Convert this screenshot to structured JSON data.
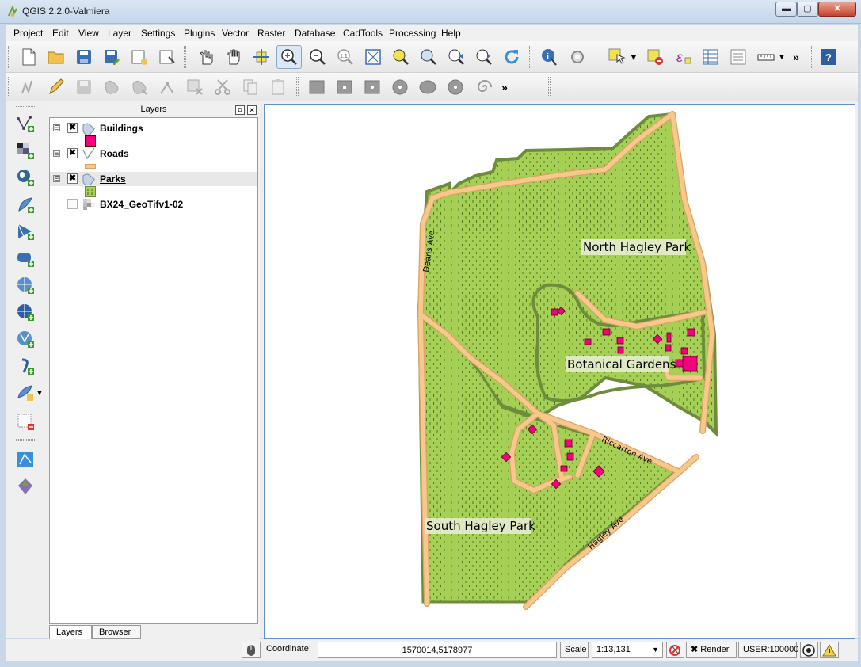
{
  "window": {
    "title": "QGIS 2.2.0-Valmiera",
    "controls": {
      "minimize": "▬",
      "maximize": "▢",
      "close": "✕"
    }
  },
  "menu": [
    "Project",
    "Edit",
    "View",
    "Layer",
    "Settings",
    "Plugins",
    "Vector",
    "Raster",
    "Database",
    "CadTools",
    "Processing",
    "Help"
  ],
  "toolbar_overflow": "»",
  "layers_panel": {
    "title": "Layers",
    "float_btn": "⧉",
    "close_btn": "✕",
    "layers": [
      {
        "name": "Buildings",
        "checked": true,
        "expander": "⊟",
        "legend_color": "#f2007e"
      },
      {
        "name": "Roads",
        "checked": true,
        "expander": "⊟",
        "legend_color": "#f7c88c"
      },
      {
        "name": "Parks",
        "checked": true,
        "expander": "⊟",
        "legend_color": "#a9d05a",
        "selected": true
      },
      {
        "name": "BX24_GeoTifv1-02",
        "checked": false
      }
    ],
    "check_mark": "✖",
    "tabs": [
      "Layers",
      "Browser"
    ]
  },
  "map": {
    "labels": {
      "north": "North Hagley Park",
      "botanical": "Botanical Gardens",
      "south": "South Hagley Park",
      "deans": "Deans Ave",
      "riccarton": "Riccarton Ave",
      "hagley": "Hagley Ave"
    },
    "colors": {
      "park_fill": "#a6cf55",
      "park_edge": "#6e8c3b",
      "road": "#f7c88c",
      "road_edge": "#d8a364",
      "building": "#f2007e"
    }
  },
  "status": {
    "coordinate_label": "Coordinate:",
    "coordinate_value": "1570014,5178977",
    "scale_label": "Scale",
    "scale_value": "1:13,131",
    "render_label": "Render",
    "render_checked": "✖",
    "crs": "USER:100000",
    "dropdown_arrow": "▼"
  }
}
